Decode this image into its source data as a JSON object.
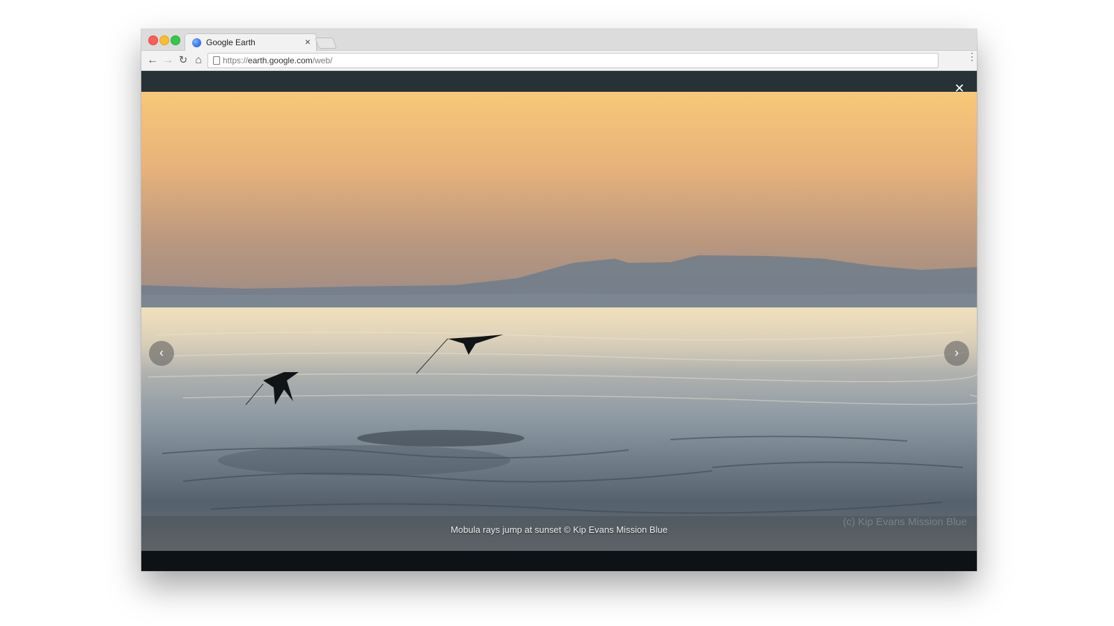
{
  "browser": {
    "tab": {
      "title": "Google Earth",
      "close_glyph": "×",
      "favicon": "google-earth-icon"
    },
    "toolbar": {
      "back_glyph": "←",
      "forward_glyph": "→",
      "reload_glyph": "↻",
      "home_glyph": "⌂",
      "url_scheme": "https://",
      "url_host": "earth.google.com",
      "url_path": "/web/",
      "menu_glyph": "⋮"
    }
  },
  "viewer": {
    "close_glyph": "✕",
    "prev_glyph": "‹",
    "next_glyph": "›",
    "caption": "Mobula rays jump at sunset © Kip Evans Mission Blue",
    "watermark": "(c) Kip Evans Mission Blue"
  },
  "colors": {
    "viewer_topbar": "#263238",
    "sky_top": "#f7c878",
    "sea": "#7a8a96"
  }
}
